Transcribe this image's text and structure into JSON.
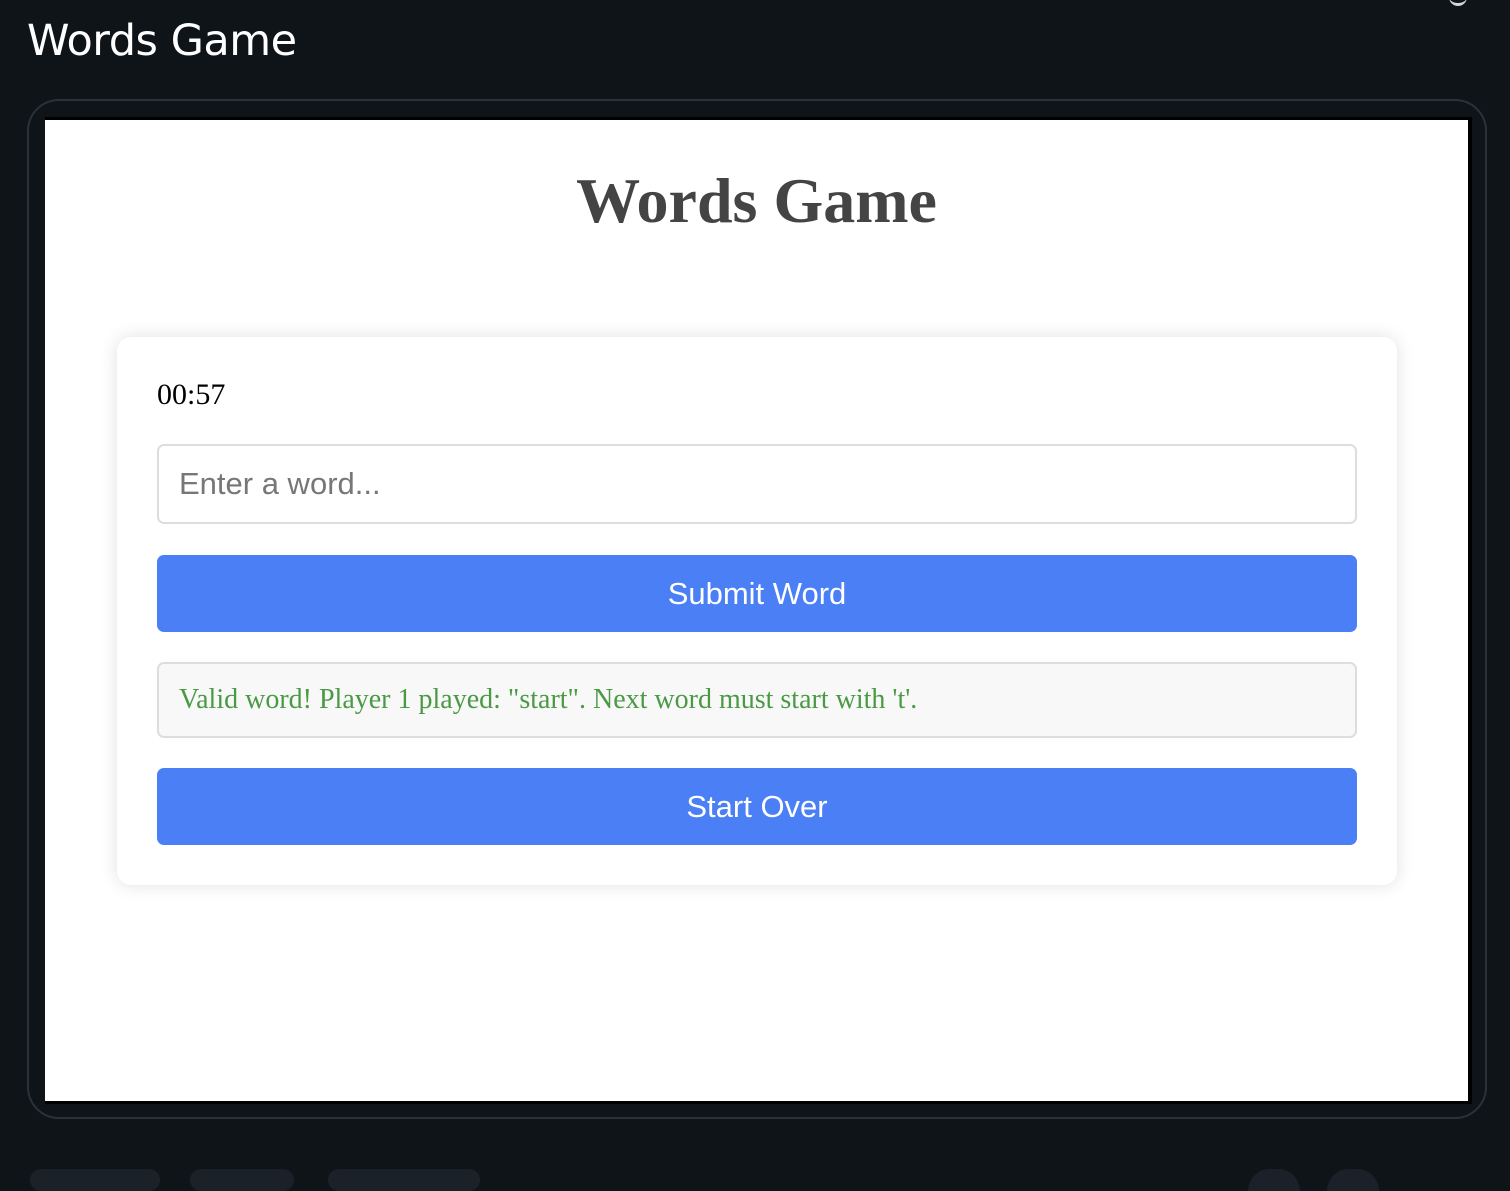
{
  "app": {
    "title": "Words Game"
  },
  "game": {
    "title": "Words Game",
    "timer": "00:57",
    "word_input": {
      "value": "",
      "placeholder": "Enter a word..."
    },
    "submit_label": "Submit Word",
    "message": "Valid word! Player 1 played: \"start\". Next word must start with 't'.",
    "start_over_label": "Start Over"
  },
  "colors": {
    "page_background": "#0f1419",
    "button_blue": "#4a7ff5",
    "success_text": "#4a9a45",
    "message_background": "#f8f8f8",
    "title_text": "#444444"
  }
}
